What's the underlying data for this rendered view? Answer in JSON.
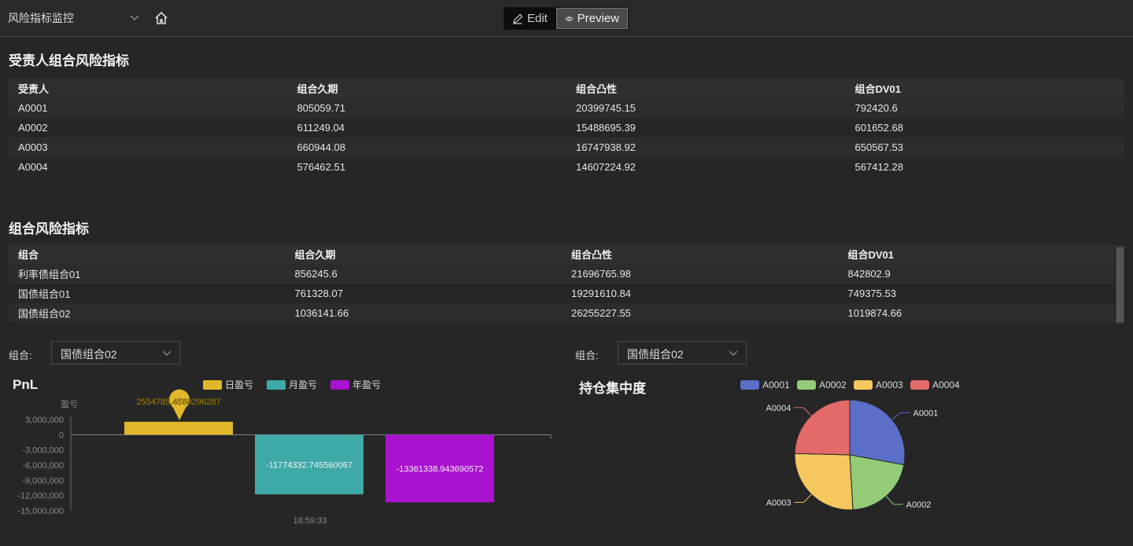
{
  "topbar": {
    "dashboard_name": "风险指标监控",
    "edit_label": "Edit",
    "preview_label": "Preview"
  },
  "section1": {
    "title": "受责人组合风险指标",
    "columns": [
      "受责人",
      "组合久期",
      "组合凸性",
      "组合DV01"
    ],
    "rows": [
      [
        "A0001",
        "805059.71",
        "20399745.15",
        "792420.6"
      ],
      [
        "A0002",
        "611249.04",
        "15488695.39",
        "601652.68"
      ],
      [
        "A0003",
        "660944.08",
        "16747938.92",
        "650567.53"
      ],
      [
        "A0004",
        "576462.51",
        "14607224.92",
        "567412.28"
      ]
    ]
  },
  "section2": {
    "title": "组合风险指标",
    "columns": [
      "组合",
      "组合久期",
      "组合凸性",
      "组合DV01"
    ],
    "rows": [
      [
        "利率债组合01",
        "856245.6",
        "21696765.98",
        "842802.9"
      ],
      [
        "国债组合01",
        "761328.07",
        "19291610.84",
        "749375.53"
      ],
      [
        "国债组合02",
        "1036141.66",
        "26255227.55",
        "1019874.66"
      ]
    ]
  },
  "filters": {
    "left": {
      "label": "组合:",
      "value": "国债组合02"
    },
    "right": {
      "label": "组合:",
      "value": "国债组合02"
    }
  },
  "pnl_chart": {
    "title": "PnL",
    "chart_data": {
      "type": "bar",
      "categories": [
        "18:59:33"
      ],
      "series": [
        {
          "name": "日盈亏",
          "values": [
            2554785.4580296287
          ],
          "label": "2554785.4580296287",
          "color": "#e0b829"
        },
        {
          "name": "月盈亏",
          "values": [
            -11774332.745560067
          ],
          "label": "-11774332.745560067",
          "color": "#3fa9a8"
        },
        {
          "name": "年盈亏",
          "values": [
            -13361338.943690572
          ],
          "label": "-13361338.943690572",
          "color": "#a912cf"
        }
      ],
      "ylabel": "盈亏",
      "ylim": [
        -15000000,
        3000000
      ],
      "yticks": [
        3000000,
        0,
        -3000000,
        -6000000,
        -9000000,
        -12000000,
        -15000000
      ],
      "ytick_labels": [
        "3,000,000",
        "0",
        "-3,000,000",
        "-6,000,000",
        "-9,000,000",
        "-12,000,000",
        "-15,000,000"
      ],
      "legend_position": "top"
    }
  },
  "pie_chart": {
    "title": "持仓集中度",
    "chart_data": {
      "type": "pie",
      "labels": [
        "A0001",
        "A0002",
        "A0003",
        "A0004"
      ],
      "values": [
        0.279,
        0.212,
        0.263,
        0.246
      ],
      "colors": [
        "#5b6fc8",
        "#93cb77",
        "#f5c85e",
        "#e46a6a"
      ],
      "legend_position": "top"
    }
  }
}
